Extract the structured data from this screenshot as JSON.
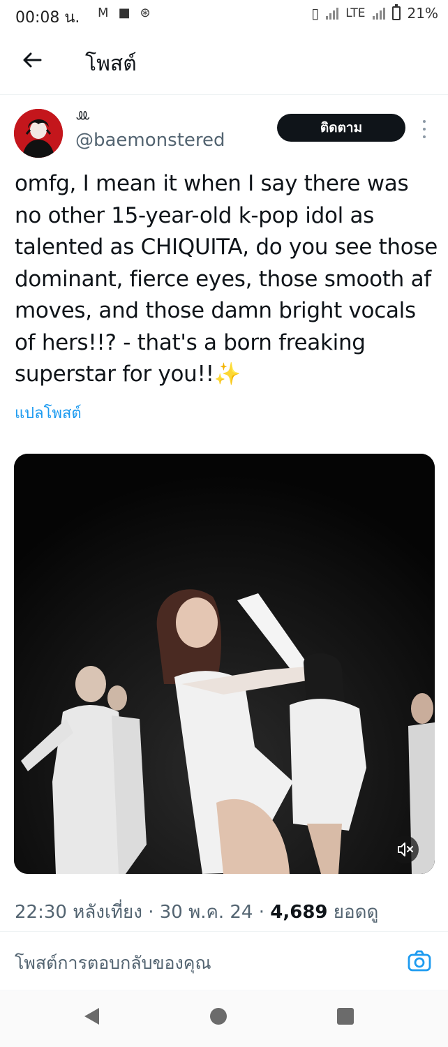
{
  "status_bar": {
    "time": "00:08 น.",
    "icons_left": [
      "gmail-icon",
      "chat-icon",
      "data-saver-icon"
    ],
    "network": "LTE",
    "battery": "21%"
  },
  "header": {
    "title": "โพสต์",
    "back_icon": "arrow-left-icon"
  },
  "post": {
    "display_name": "ꔛ",
    "handle": "@baemonstered",
    "follow_label": "ติดตาม",
    "text": "omfg, I mean it when I say there was no other 15-year-old k-pop idol as talented as CHIQUITA, do you see those dominant, fierce eyes, those smooth af moves, and those damn bright vocals of hers!!? - that's a born freaking superstar for you!!✨",
    "translate_label": "แปลโพสต์",
    "time": "22:30 หลังเที่ยง",
    "date": "30 พ.ค. 24",
    "views_count": "4,689",
    "views_label": "ยอดดู"
  },
  "reply": {
    "placeholder": "โพสต์การตอบกลับของคุณ"
  },
  "colors": {
    "link": "#1d9bf0",
    "follow_bg": "#0f1419",
    "secondary_text": "#536471"
  }
}
